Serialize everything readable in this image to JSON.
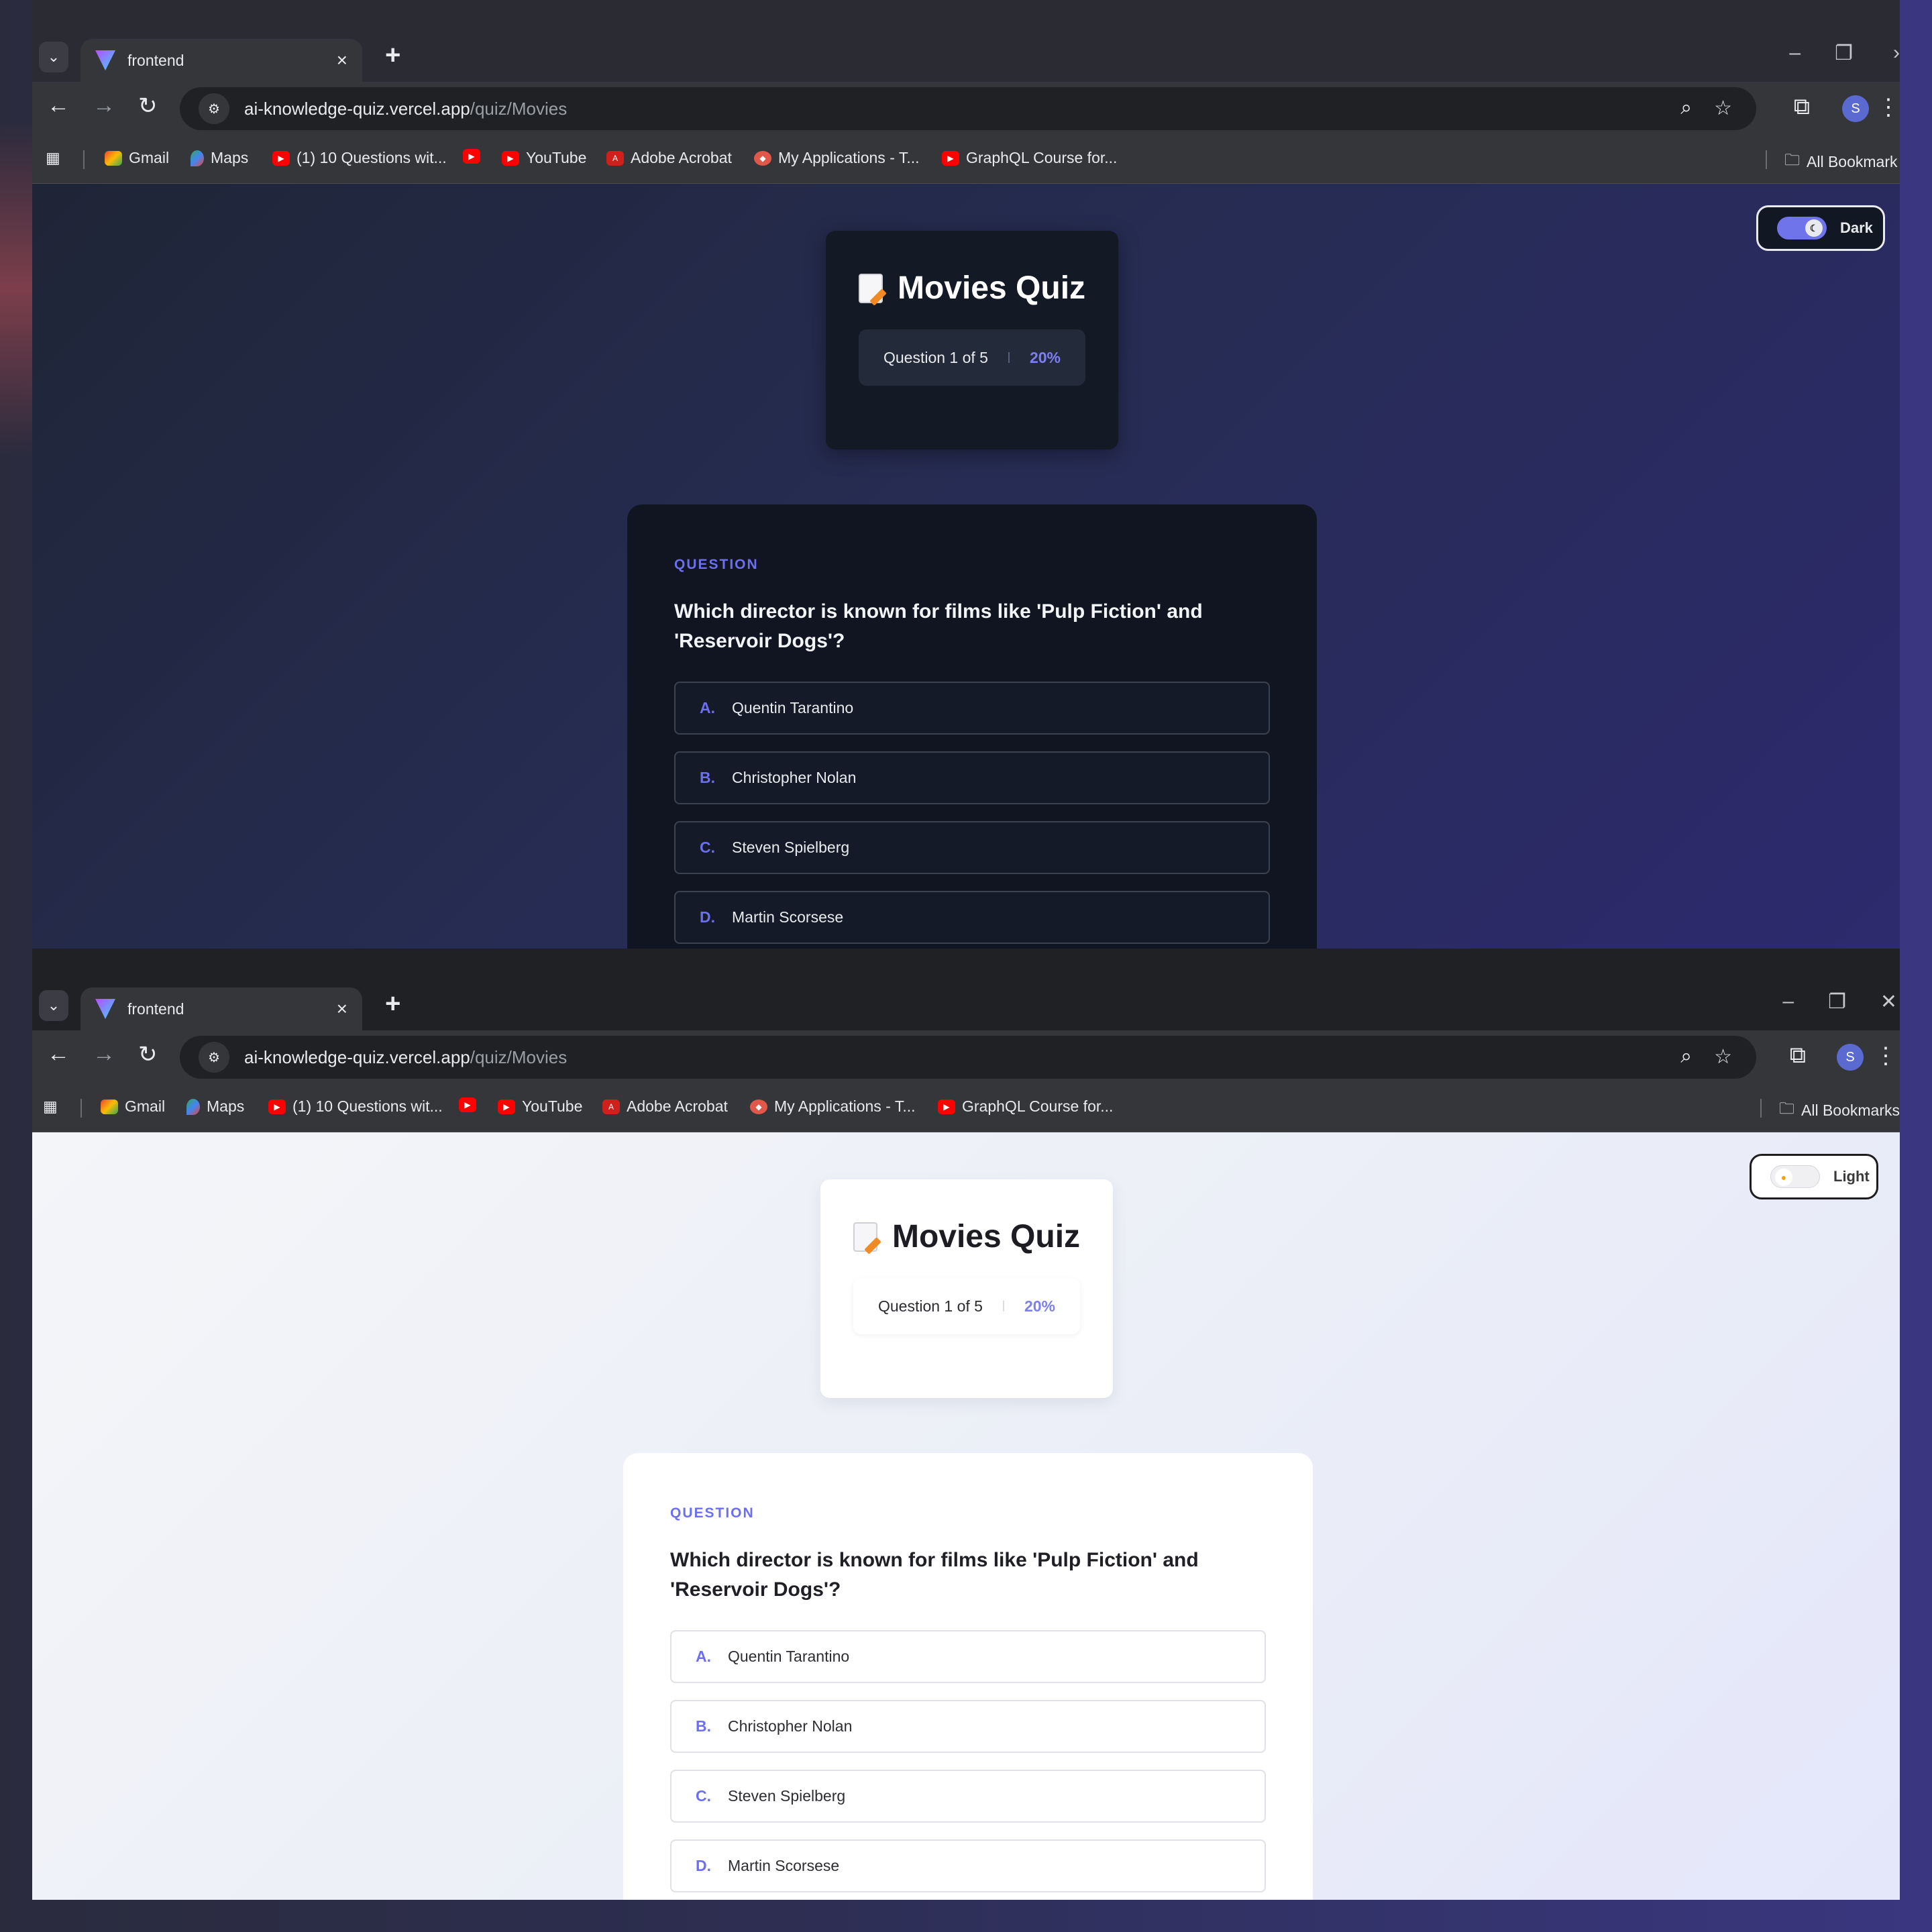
{
  "browser": {
    "tab_title": "frontend",
    "url_host": "ai-knowledge-quiz.vercel.app",
    "url_path": "/quiz/Movies",
    "profile_initial": "S",
    "bookmarks": [
      {
        "label": "Gmail"
      },
      {
        "label": "Maps"
      },
      {
        "label": "(1) 10 Questions wit..."
      },
      {
        "label": ""
      },
      {
        "label": "YouTube"
      },
      {
        "label": "Adobe Acrobat"
      },
      {
        "label": "My Applications - T..."
      },
      {
        "label": "GraphQL Course for..."
      }
    ],
    "all_bookmarks": "All Bookmarks",
    "all_bookmarks_dark": "All Bookmark"
  },
  "quiz": {
    "title": "Movies Quiz",
    "progress_text": "Question 1 of 5",
    "progress_percent": "20%",
    "question_label": "QUESTION",
    "question_text": "Which director is known for films like 'Pulp Fiction' and 'Reservoir Dogs'?",
    "options": [
      {
        "letter": "A.",
        "text": "Quentin Tarantino"
      },
      {
        "letter": "B.",
        "text": "Christopher Nolan"
      },
      {
        "letter": "C.",
        "text": "Steven Spielberg"
      },
      {
        "letter": "D.",
        "text": "Martin Scorsese"
      }
    ]
  },
  "theme": {
    "dark_label": "Dark",
    "light_label": "Light"
  },
  "colors": {
    "accent": "#6c6ff0"
  }
}
